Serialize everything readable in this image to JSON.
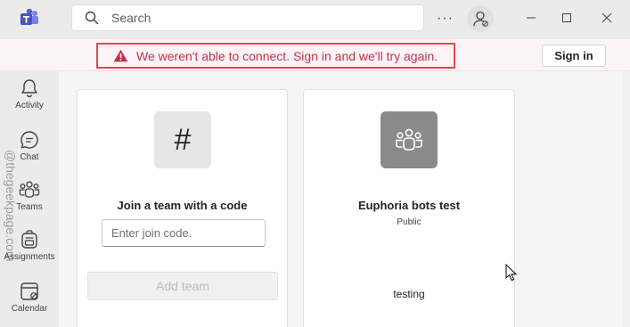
{
  "titlebar": {
    "search_placeholder": "Search",
    "more_label": "···"
  },
  "banner": {
    "message": "We weren't able to connect. Sign in and we'll try again.",
    "signin_label": "Sign in"
  },
  "rail": {
    "items": [
      {
        "label": "Activity",
        "icon": "bell-icon"
      },
      {
        "label": "Chat",
        "icon": "chat-icon"
      },
      {
        "label": "Teams",
        "icon": "teams-icon"
      },
      {
        "label": "Assignments",
        "icon": "backpack-icon"
      },
      {
        "label": "Calendar",
        "icon": "calendar-icon"
      }
    ]
  },
  "cards": {
    "join": {
      "title": "Join a team with a code",
      "input_placeholder": "Enter join code.",
      "button_label": "Add team"
    },
    "team": {
      "name": "Euphoria bots test",
      "visibility": "Public",
      "description": "testing"
    }
  },
  "watermark": "@thegeekpage.com",
  "colors": {
    "error": "#c4314b",
    "highlight_box": "#e04b4b",
    "teams_purple": "#5b5fc7"
  }
}
